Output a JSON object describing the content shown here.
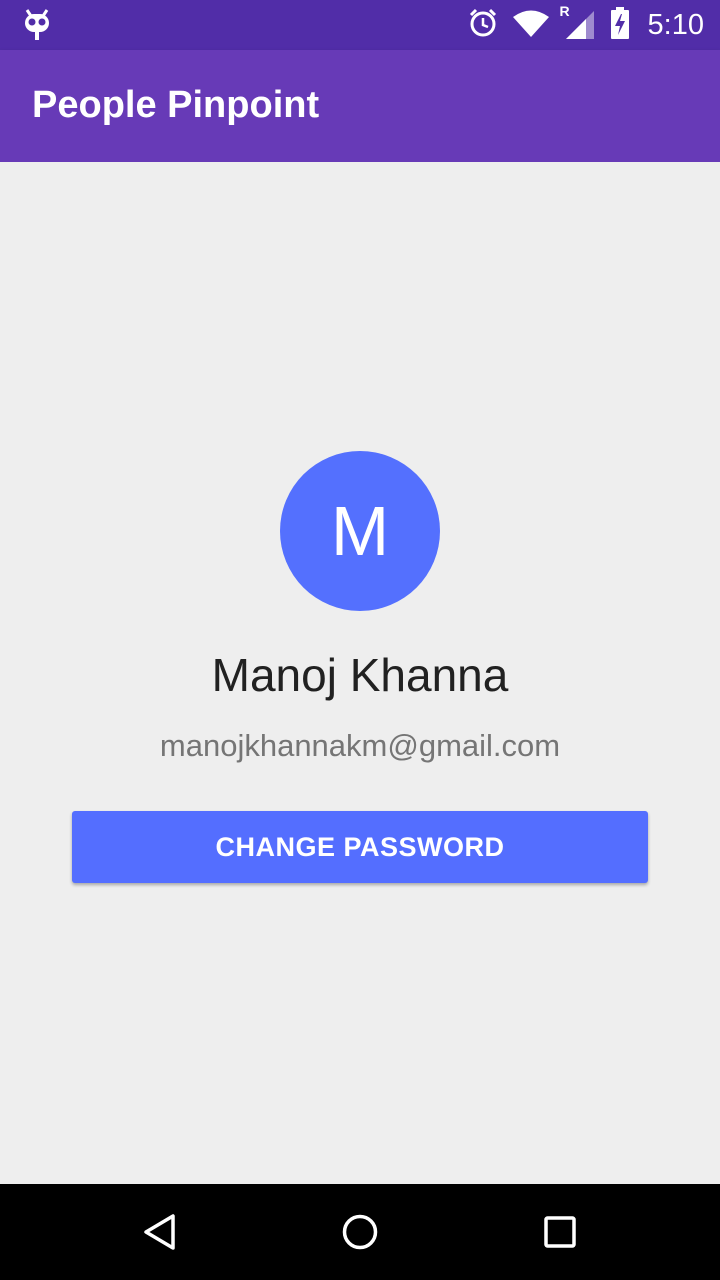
{
  "status_bar": {
    "time": "5:10",
    "icons": [
      "cyanogenmod-bugdroid-icon",
      "alarm-icon",
      "wifi-icon",
      "signal-roaming-icon",
      "battery-charging-icon"
    ],
    "roaming_label": "R"
  },
  "app_bar": {
    "title": "People Pinpoint"
  },
  "profile": {
    "avatar_initial": "M",
    "name": "Manoj Khanna",
    "email": "manojkhannakm@gmail.com"
  },
  "actions": {
    "change_password_label": "CHANGE PASSWORD"
  },
  "nav_bar": {
    "icons": [
      "back-icon",
      "home-icon",
      "recents-icon"
    ]
  },
  "colors": {
    "status_bar": "#512da8",
    "app_bar": "#673ab7",
    "accent": "#546eff",
    "background": "#eeeeee"
  }
}
